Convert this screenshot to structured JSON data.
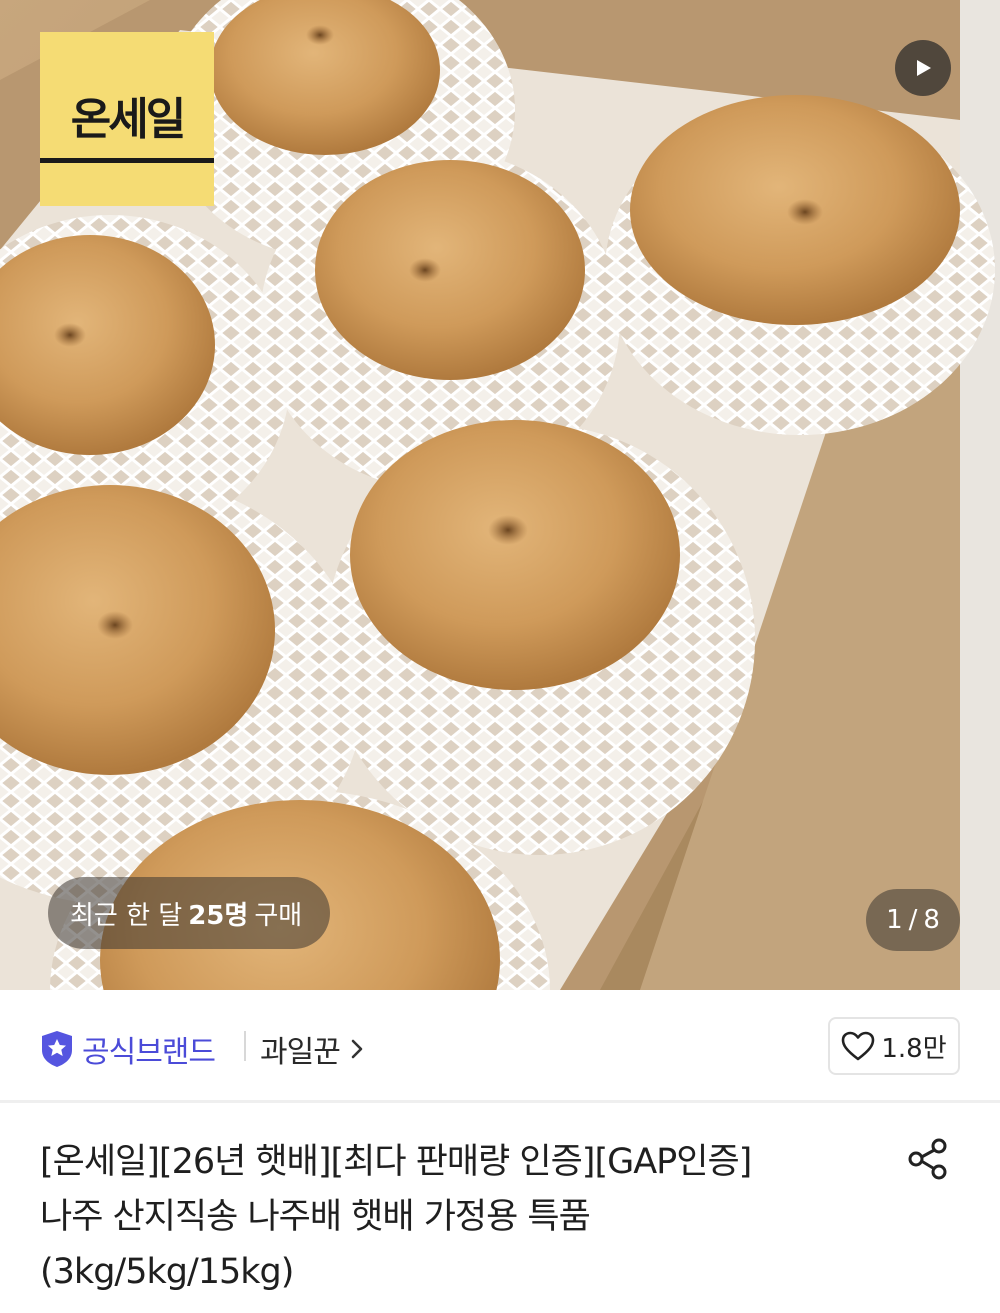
{
  "hero": {
    "logo_text": "온세일",
    "recent_prefix": "최근 한 달",
    "recent_count": "25명",
    "recent_suffix": "구매",
    "page_current": "1",
    "page_separator": "/",
    "page_total": "8",
    "icons": {
      "play": "play-icon"
    }
  },
  "brand": {
    "official_label": "공식브랜드",
    "seller_name": "과일꾼",
    "like_count": "1.8만",
    "accent_color": "#4b4bd8",
    "icons": {
      "official": "star-shield-icon",
      "seller": "chevron-right-icon",
      "like": "heart-icon"
    }
  },
  "product": {
    "title_lines": [
      "[온세일][26년 햇배][최다 판매량 인증][GAP인증]",
      "나주 산지직송 나주배 햇배 가정용 특품",
      "(3kg/5kg/15kg)"
    ],
    "icons": {
      "share": "share-icon"
    }
  }
}
